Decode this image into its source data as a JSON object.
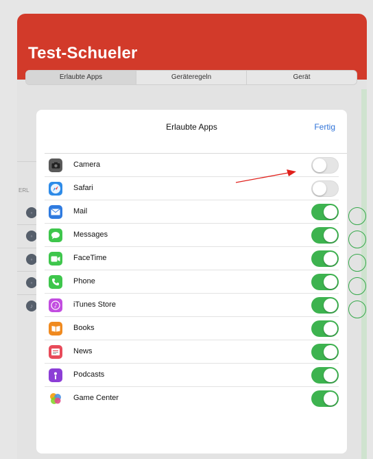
{
  "header": {
    "title": "Test-Schueler"
  },
  "segments": [
    "Erlaubte Apps",
    "Geräteregeln",
    "Gerät"
  ],
  "background": {
    "section_label": "ERL"
  },
  "modal": {
    "title": "Erlaubte Apps",
    "done_label": "Fertig"
  },
  "apps": [
    {
      "name": "Camera",
      "icon": "camera-icon",
      "color": "#5a5a5a",
      "enabled": false
    },
    {
      "name": "Safari",
      "icon": "safari-icon",
      "color": "#2e8be8",
      "enabled": false
    },
    {
      "name": "Mail",
      "icon": "mail-icon",
      "color": "#2f7be0",
      "enabled": true
    },
    {
      "name": "Messages",
      "icon": "messages-icon",
      "color": "#3ec64c",
      "enabled": true
    },
    {
      "name": "FaceTime",
      "icon": "facetime-icon",
      "color": "#3ec64c",
      "enabled": true
    },
    {
      "name": "Phone",
      "icon": "phone-icon",
      "color": "#3ec64c",
      "enabled": true
    },
    {
      "name": "iTunes Store",
      "icon": "itunes-store-icon",
      "color": "#c24de0",
      "enabled": true
    },
    {
      "name": "Books",
      "icon": "books-icon",
      "color": "#f08a1f",
      "enabled": true
    },
    {
      "name": "News",
      "icon": "news-icon",
      "color": "#e84b5a",
      "enabled": true
    },
    {
      "name": "Podcasts",
      "icon": "podcasts-icon",
      "color": "#8c3ed6",
      "enabled": true
    },
    {
      "name": "Game Center",
      "icon": "game-center-icon",
      "color": "#e24a8a",
      "enabled": true
    }
  ],
  "colors": {
    "accent": "#2f73d8",
    "toggle_on": "#3db34f",
    "header": "#d23a2a",
    "arrow": "#e0201b"
  }
}
